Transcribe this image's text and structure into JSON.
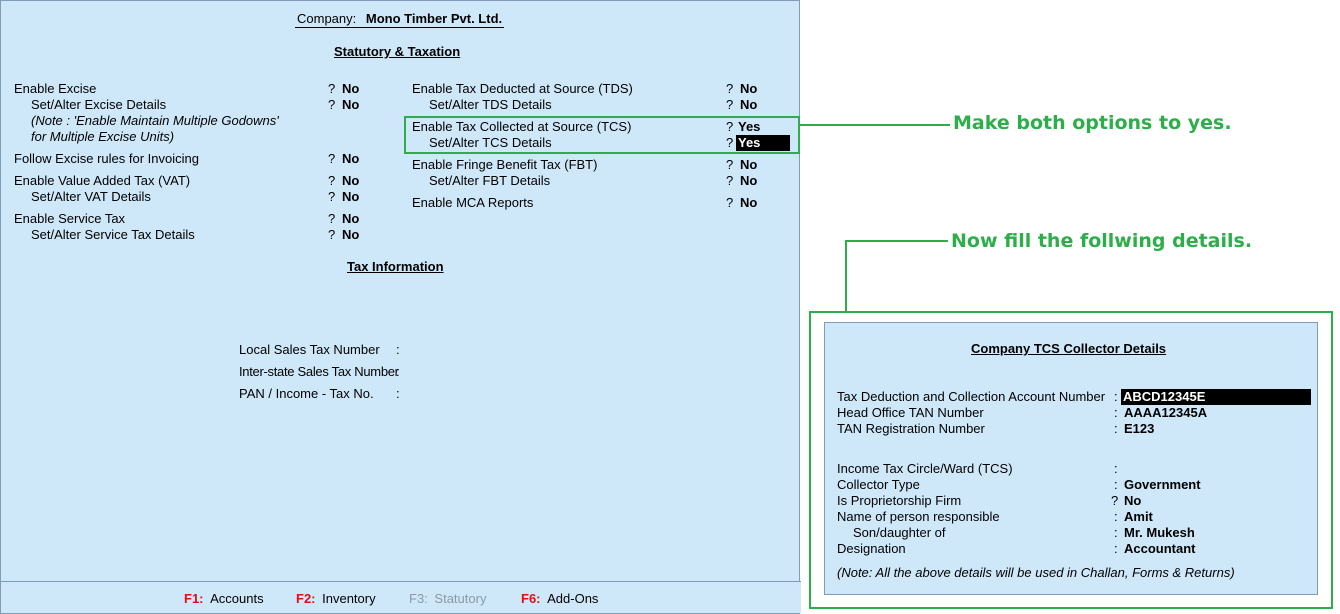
{
  "company": {
    "label": "Company:",
    "name": "Mono Timber Pvt. Ltd."
  },
  "section_title": "Statutory & Taxation",
  "left_options": [
    {
      "label": "Enable Excise",
      "value": "No"
    },
    {
      "label": "Set/Alter Excise Details",
      "value": "No"
    },
    {
      "label": "(Note : 'Enable Maintain Multiple Godowns'"
    },
    {
      "label": "for Multiple Excise Units)"
    },
    {
      "label": "Follow Excise rules for Invoicing",
      "value": "No"
    },
    {
      "label": "Enable Value Added Tax (VAT)",
      "value": "No"
    },
    {
      "label": "Set/Alter VAT Details",
      "value": "No"
    },
    {
      "label": "Enable Service Tax",
      "value": "No"
    },
    {
      "label": "Set/Alter Service Tax Details",
      "value": "No"
    }
  ],
  "right_options": [
    {
      "label": "Enable Tax Deducted at Source (TDS)",
      "value": "No"
    },
    {
      "label": "Set/Alter TDS Details",
      "value": "No"
    },
    {
      "label": "Enable Tax Collected at Source (TCS)",
      "value": "Yes"
    },
    {
      "label": "Set/Alter TCS Details",
      "value": "Yes"
    },
    {
      "label": "Enable Fringe Benefit Tax (FBT)",
      "value": "No"
    },
    {
      "label": "Set/Alter FBT Details",
      "value": "No"
    },
    {
      "label": "Enable MCA Reports",
      "value": "No"
    }
  ],
  "question_mark": "?",
  "colon": ":",
  "tax_info": {
    "title": "Tax Information",
    "fields": [
      {
        "label": "Local Sales Tax Number",
        "value": ""
      },
      {
        "label": "Inter-state Sales Tax Number",
        "value": ""
      },
      {
        "label": "PAN / Income - Tax No.",
        "value": ""
      }
    ]
  },
  "footer": [
    {
      "key": "F1:",
      "label": "Accounts",
      "enabled": true
    },
    {
      "key": "F2:",
      "label": "Inventory",
      "enabled": true
    },
    {
      "key": "F3:",
      "label": "Statutory",
      "enabled": false
    },
    {
      "key": "F6:",
      "label": "Add-Ons",
      "enabled": true
    }
  ],
  "annotations": {
    "make_yes": "Make both options to yes.",
    "fill_details": "Now fill the follwing details."
  },
  "tcs": {
    "title": "Company TCS Collector Details",
    "fields": [
      {
        "label": "Tax Deduction and Collection Account Number",
        "sep": ":",
        "value": "ABCD12345E"
      },
      {
        "label": "Head Office TAN Number",
        "sep": ":",
        "value": "AAAA12345A"
      },
      {
        "label": "TAN Registration Number",
        "sep": ":",
        "value": "E123"
      },
      {
        "label": "Income Tax Circle/Ward (TCS)",
        "sep": ":",
        "value": ""
      },
      {
        "label": "Collector Type",
        "sep": ":",
        "value": "Government"
      },
      {
        "label": "Is Proprietorship Firm",
        "sep": "?",
        "value": "No"
      },
      {
        "label": "Name of person responsible",
        "sep": ":",
        "value": "Amit"
      },
      {
        "label": "Son/daughter of",
        "sep": ":",
        "value": "Mr. Mukesh"
      },
      {
        "label": "Designation",
        "sep": ":",
        "value": "Accountant"
      }
    ],
    "note": "(Note: All the above details will be used in Challan, Forms & Returns)"
  },
  "colors": {
    "panel": "#cfe8f9",
    "annotation": "#2eae4a",
    "fkey": "#dd1111"
  }
}
